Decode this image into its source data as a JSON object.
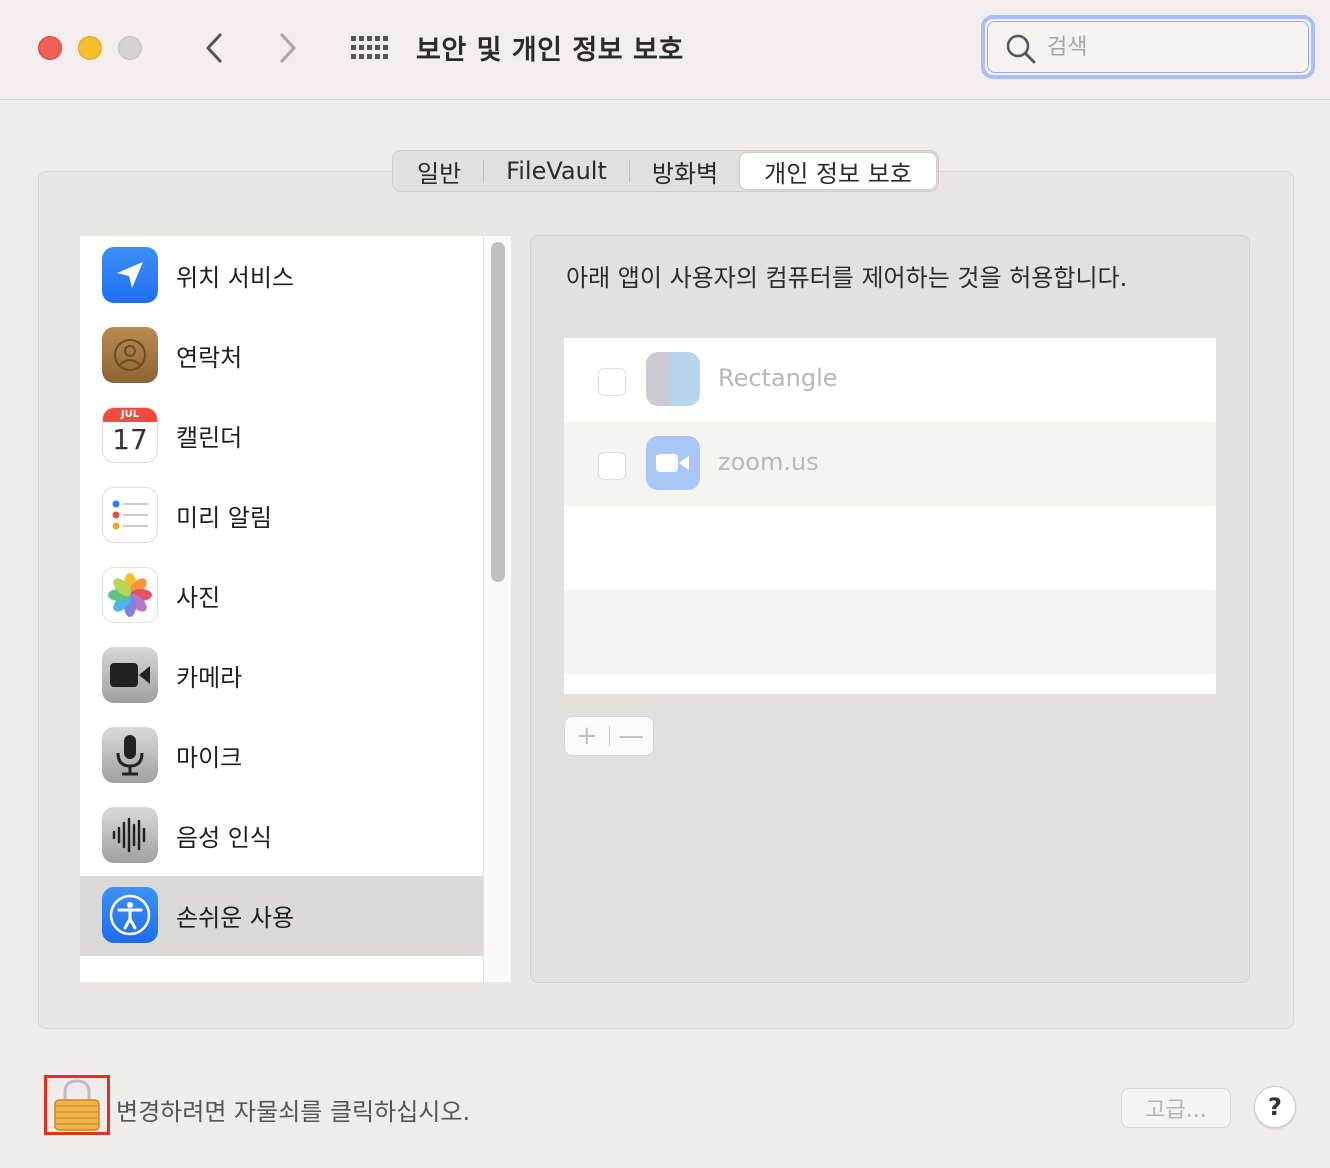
{
  "window": {
    "title": "보안 및 개인 정보 보호",
    "search_placeholder": "검색"
  },
  "tabs": [
    {
      "label": "일반",
      "active": false
    },
    {
      "label": "FileVault",
      "active": false
    },
    {
      "label": "방화벽",
      "active": false
    },
    {
      "label": "개인 정보 보호",
      "active": true
    }
  ],
  "sidebar": {
    "items": [
      {
        "label": "위치 서비스",
        "icon": "location-arrow-icon"
      },
      {
        "label": "연락처",
        "icon": "contacts-icon"
      },
      {
        "label": "캘린더",
        "icon": "calendar-icon",
        "calendar_month": "JUL",
        "calendar_day": "17"
      },
      {
        "label": "미리 알림",
        "icon": "reminders-icon"
      },
      {
        "label": "사진",
        "icon": "photos-icon"
      },
      {
        "label": "카메라",
        "icon": "camera-icon"
      },
      {
        "label": "마이크",
        "icon": "microphone-icon"
      },
      {
        "label": "음성 인식",
        "icon": "speech-recognition-icon"
      },
      {
        "label": "손쉬운 사용",
        "icon": "accessibility-icon",
        "selected": true
      }
    ]
  },
  "content": {
    "description": "아래 앱이 사용자의 컴퓨터를 제어하는 것을 허용합니다.",
    "apps": [
      {
        "name": "Rectangle",
        "checked": false
      },
      {
        "name": "zoom.us",
        "checked": false
      }
    ],
    "add_symbol": "+",
    "remove_symbol": "—"
  },
  "footer": {
    "lock_text": "변경하려면 자물쇠를 클릭하십시오.",
    "advanced_label": "고급...",
    "help_label": "?"
  },
  "colors": {
    "accent": "#2f7cf6",
    "close": "#ed5f57",
    "minimize": "#f5be2f",
    "highlight_border": "#e2311c"
  }
}
